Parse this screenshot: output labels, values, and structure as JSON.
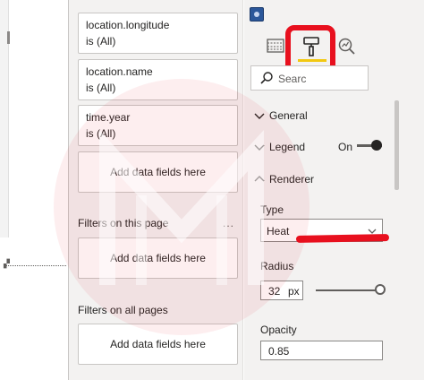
{
  "filters": {
    "cards": [
      {
        "field": "location.longitude",
        "value": "is (All)"
      },
      {
        "field": "location.name",
        "value": "is (All)"
      },
      {
        "field": "time.year",
        "value": "is (All)"
      }
    ],
    "add_visual_label": "Add data fields here",
    "page_section": {
      "title": "Filters on this page",
      "more": "...",
      "add_label": "Add data fields here"
    },
    "all_section": {
      "title": "Filters on all pages",
      "add_label": "Add data fields here"
    }
  },
  "viz": {
    "search_placeholder": "Searc",
    "sections": {
      "general": "General",
      "legend": "Legend",
      "legend_state": "On",
      "renderer": "Renderer"
    },
    "type": {
      "label": "Type",
      "value": "Heat"
    },
    "radius": {
      "label": "Radius",
      "value": "32",
      "unit": "px",
      "slider_fraction": 1.0
    },
    "opacity": {
      "label": "Opacity",
      "value": "0.85"
    }
  },
  "colors": {
    "highlight_red": "#e8101e",
    "accent_yellow": "#f2c811",
    "pane_bg": "#f3f2f1"
  },
  "icons": {
    "fields_tab": "table-icon",
    "format_tab": "paint-roller-icon",
    "analytics_tab": "magnifier-analytics-icon",
    "search": "search-icon"
  }
}
